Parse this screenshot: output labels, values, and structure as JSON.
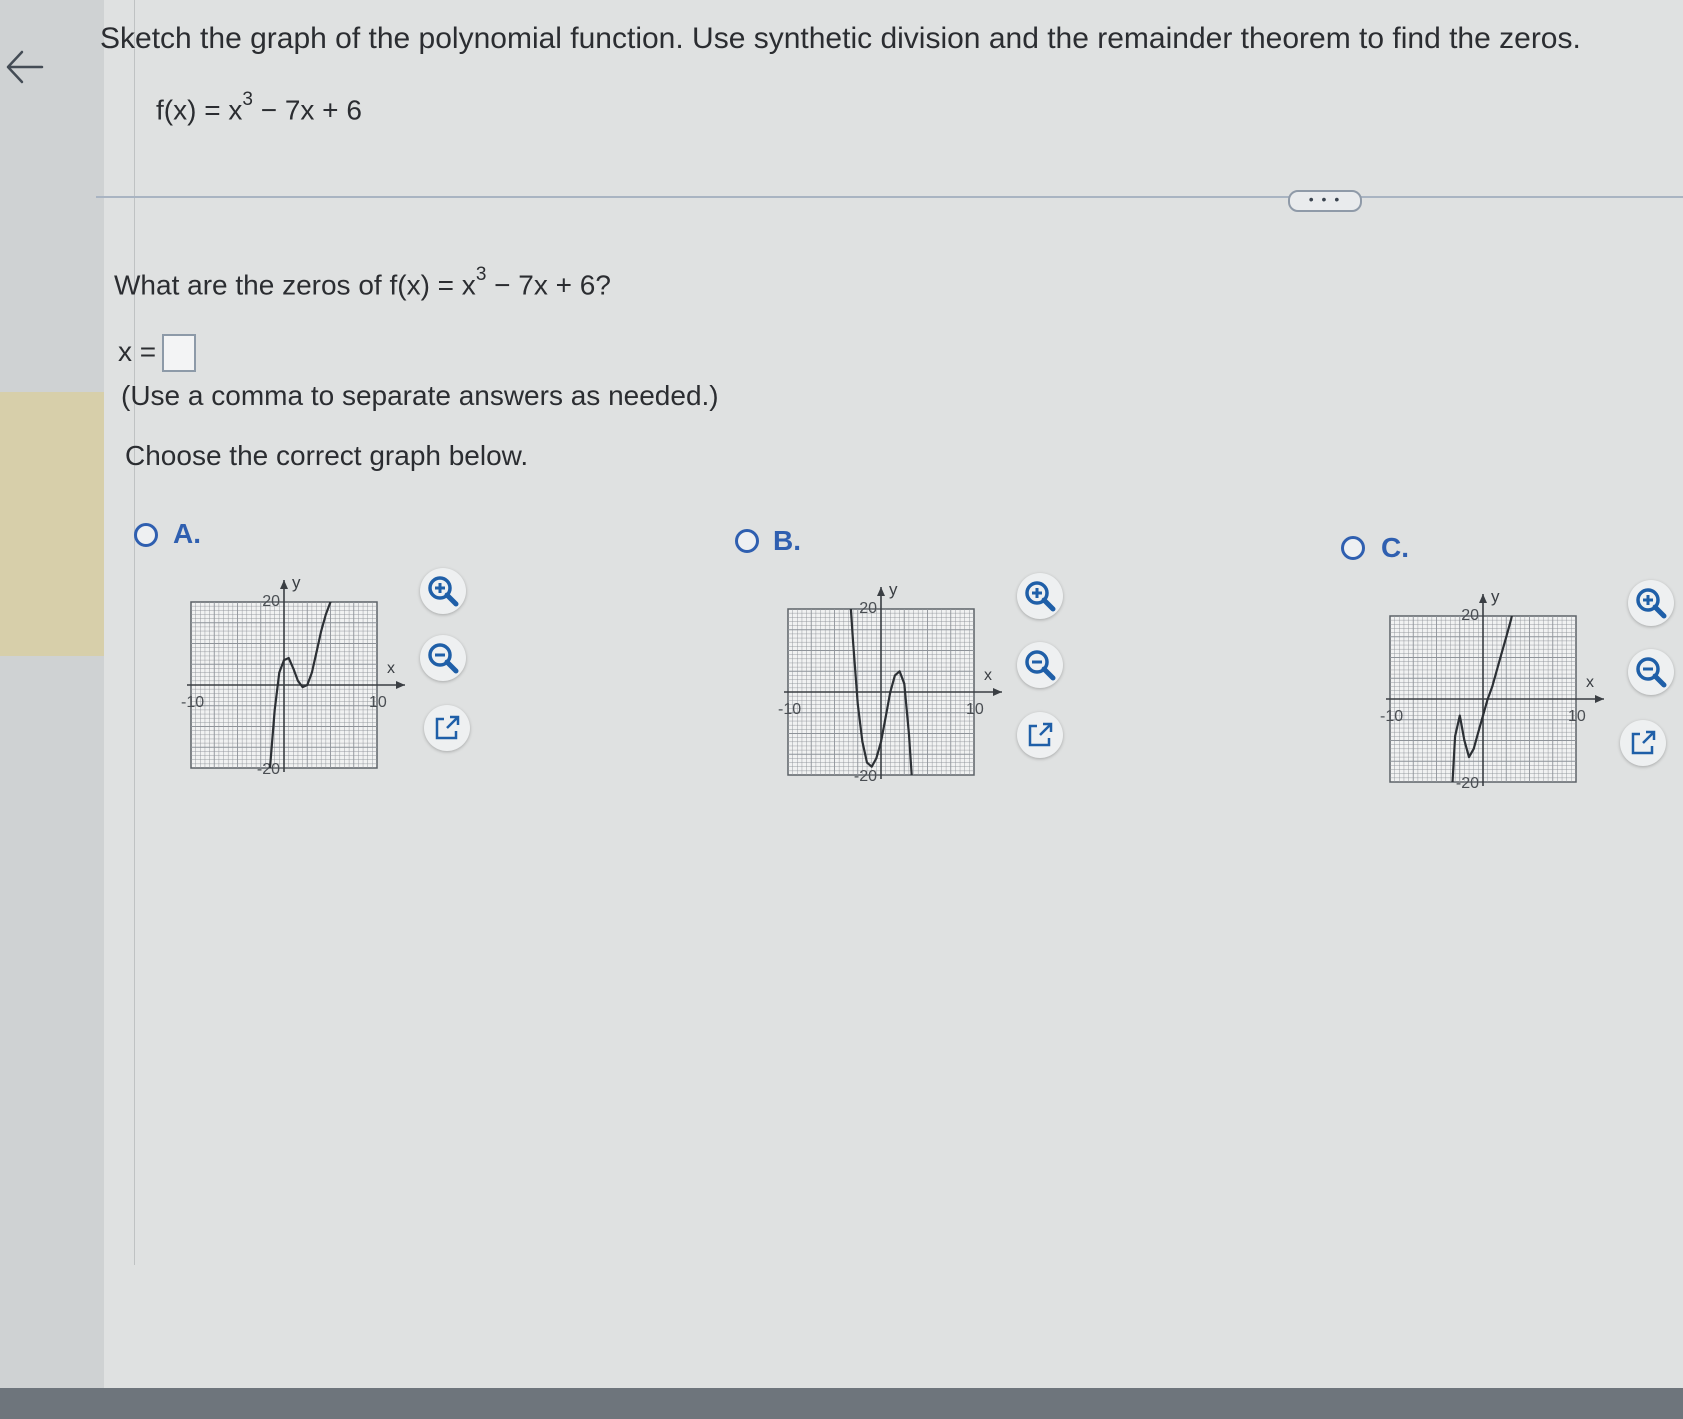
{
  "problem": {
    "instruction": "Sketch the graph of the polynomial function. Use synthetic division and the remainder theorem to find the zeros.",
    "function_lhs": "f(x) = x",
    "function_exp": "3",
    "function_rhs": " − 7x + 6"
  },
  "expand_label": "• • •",
  "question": {
    "prefix": "What are the zeros of f(x) = x",
    "exp": "3",
    "suffix": " − 7x + 6?",
    "answer_label": "x =",
    "answer_value": "",
    "hint": "(Use a comma to separate answers as needed.)",
    "choose_prompt": "Choose the correct graph below."
  },
  "options": [
    {
      "label": "A.",
      "axis_labels": {
        "x": "x",
        "y": "y",
        "ymax": "20",
        "ymin": "-20",
        "xmin": "-10",
        "xmax": "10"
      },
      "chart_data": {
        "type": "line",
        "xlim": [
          -10,
          10
        ],
        "ylim": [
          -20,
          20
        ],
        "grid": true,
        "series": [
          {
            "x": [
              -1.5,
              -1,
              -0.5,
              0,
              0.5,
              1,
              1.5,
              2,
              2.5,
              3,
              3.5,
              4,
              4.5,
              5,
              5.5
            ],
            "y": [
              -20,
              -6,
              3,
              6,
              6.5,
              4,
              1,
              -0.5,
              0,
              3,
              8,
              13,
              17,
              20,
              24
            ]
          }
        ]
      }
    },
    {
      "label": "B.",
      "axis_labels": {
        "x": "x",
        "y": "y",
        "ymax": "20",
        "ymin": "-20",
        "xmin": "-10",
        "xmax": "10"
      },
      "chart_data": {
        "type": "line",
        "xlim": [
          -10,
          10
        ],
        "ylim": [
          -20,
          20
        ],
        "grid": true,
        "series": [
          {
            "x": [
              -3.3,
              -3,
              -2.5,
              -2,
              -1.5,
              -1,
              -0.5,
              0,
              0.5,
              1,
              1.5,
              2,
              2.5,
              3,
              3.3
            ],
            "y": [
              22,
              12,
              -3,
              -12,
              -17,
              -18,
              -16,
              -12,
              -6,
              0,
              4,
              5,
              2,
              -10,
              -20
            ]
          }
        ]
      }
    },
    {
      "label": "C.",
      "axis_labels": {
        "x": "x",
        "y": "y",
        "ymax": "20",
        "ymin": "-20",
        "xmin": "-10",
        "xmax": "10"
      },
      "chart_data": {
        "type": "line",
        "xlim": [
          -10,
          10
        ],
        "ylim": [
          -20,
          20
        ],
        "grid": true,
        "series": [
          {
            "x": [
              -3.3,
              -3,
              -2.5,
              -2,
              -1.5,
              -1,
              -0.5,
              0,
              0.5,
              1,
              1.5,
              2,
              2.5,
              3,
              3.3
            ],
            "y": [
              -21,
              -9,
              -4,
              -10,
              -14,
              -12,
              -8,
              -4,
              0,
              3,
              7,
              11,
              15,
              19,
              22
            ]
          }
        ]
      }
    }
  ]
}
